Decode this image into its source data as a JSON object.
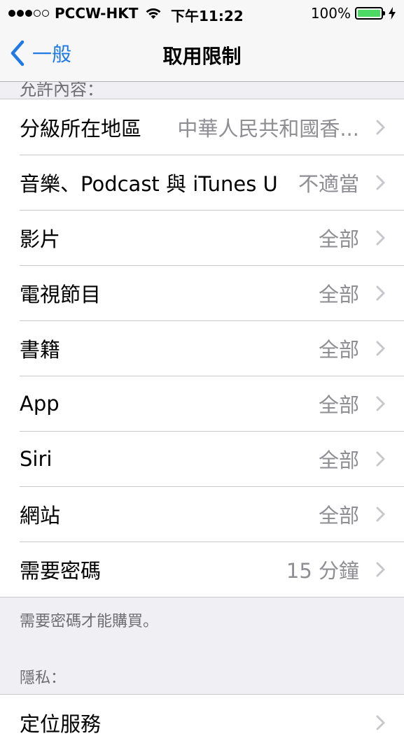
{
  "status_bar": {
    "carrier": "PCCW-HKT",
    "time": "下午11:22",
    "battery": "100%",
    "battery_level": 1.0,
    "signal_bars_filled": 3,
    "signal_bars_total": 5
  },
  "nav": {
    "back_label": "一般",
    "title": "取用限制"
  },
  "section_allowed": {
    "header": "允許內容："
  },
  "content_rows": [
    {
      "label": "分級所在地區",
      "value": "中華人民共和國香..."
    },
    {
      "label": "音樂、Podcast 與 iTunes U",
      "value": "不適當"
    },
    {
      "label": "影片",
      "value": "全部"
    },
    {
      "label": "電視節目",
      "value": "全部"
    },
    {
      "label": "書籍",
      "value": "全部"
    },
    {
      "label": "App",
      "value": "全部"
    },
    {
      "label": "Siri",
      "value": "全部"
    },
    {
      "label": "網站",
      "value": "全部"
    },
    {
      "label": "需要密碼",
      "value": "15 分鐘"
    }
  ],
  "footer_note": "需要密碼才能購買。",
  "section_privacy": {
    "header": "隱私：",
    "first_row_label": "定位服務"
  },
  "colors": {
    "accent": "#1f7ae6",
    "battery": "#4cd964",
    "background": "#efeff4"
  }
}
